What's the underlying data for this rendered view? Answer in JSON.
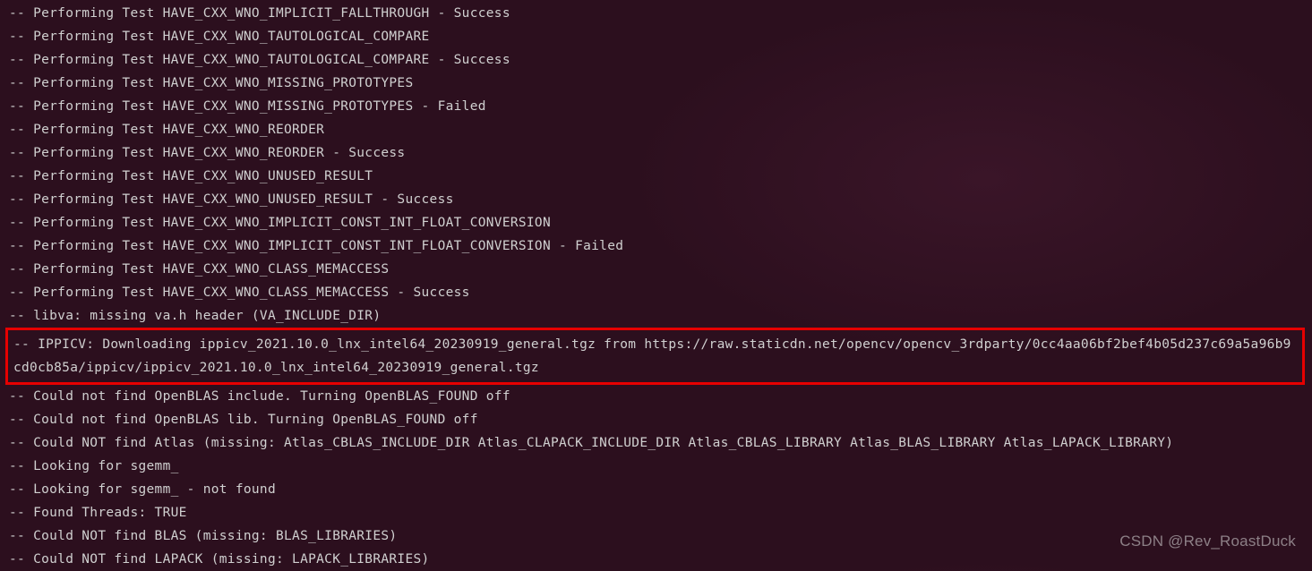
{
  "terminal": {
    "lines_before": [
      "-- Performing Test HAVE_CXX_WNO_IMPLICIT_FALLTHROUGH - Success",
      "-- Performing Test HAVE_CXX_WNO_TAUTOLOGICAL_COMPARE",
      "-- Performing Test HAVE_CXX_WNO_TAUTOLOGICAL_COMPARE - Success",
      "-- Performing Test HAVE_CXX_WNO_MISSING_PROTOTYPES",
      "-- Performing Test HAVE_CXX_WNO_MISSING_PROTOTYPES - Failed",
      "-- Performing Test HAVE_CXX_WNO_REORDER",
      "-- Performing Test HAVE_CXX_WNO_REORDER - Success",
      "-- Performing Test HAVE_CXX_WNO_UNUSED_RESULT",
      "-- Performing Test HAVE_CXX_WNO_UNUSED_RESULT - Success",
      "-- Performing Test HAVE_CXX_WNO_IMPLICIT_CONST_INT_FLOAT_CONVERSION",
      "-- Performing Test HAVE_CXX_WNO_IMPLICIT_CONST_INT_FLOAT_CONVERSION - Failed",
      "-- Performing Test HAVE_CXX_WNO_CLASS_MEMACCESS",
      "-- Performing Test HAVE_CXX_WNO_CLASS_MEMACCESS - Success",
      "-- libva: missing va.h header (VA_INCLUDE_DIR)"
    ],
    "highlighted": "-- IPPICV: Downloading ippicv_2021.10.0_lnx_intel64_20230919_general.tgz from https://raw.staticdn.net/opencv/opencv_3rdparty/0cc4aa06bf2bef4b05d237c69a5a96b9cd0cb85a/ippicv/ippicv_2021.10.0_lnx_intel64_20230919_general.tgz",
    "lines_after": [
      "-- Could not find OpenBLAS include. Turning OpenBLAS_FOUND off",
      "-- Could not find OpenBLAS lib. Turning OpenBLAS_FOUND off",
      "-- Could NOT find Atlas (missing: Atlas_CBLAS_INCLUDE_DIR Atlas_CLAPACK_INCLUDE_DIR Atlas_CBLAS_LIBRARY Atlas_BLAS_LIBRARY Atlas_LAPACK_LIBRARY)",
      "-- Looking for sgemm_",
      "-- Looking for sgemm_ - not found",
      "-- Found Threads: TRUE",
      "-- Could NOT find BLAS (missing: BLAS_LIBRARIES)",
      "-- Could NOT find LAPACK (missing: LAPACK_LIBRARIES)"
    ]
  },
  "watermark": "CSDN @Rev_RoastDuck"
}
